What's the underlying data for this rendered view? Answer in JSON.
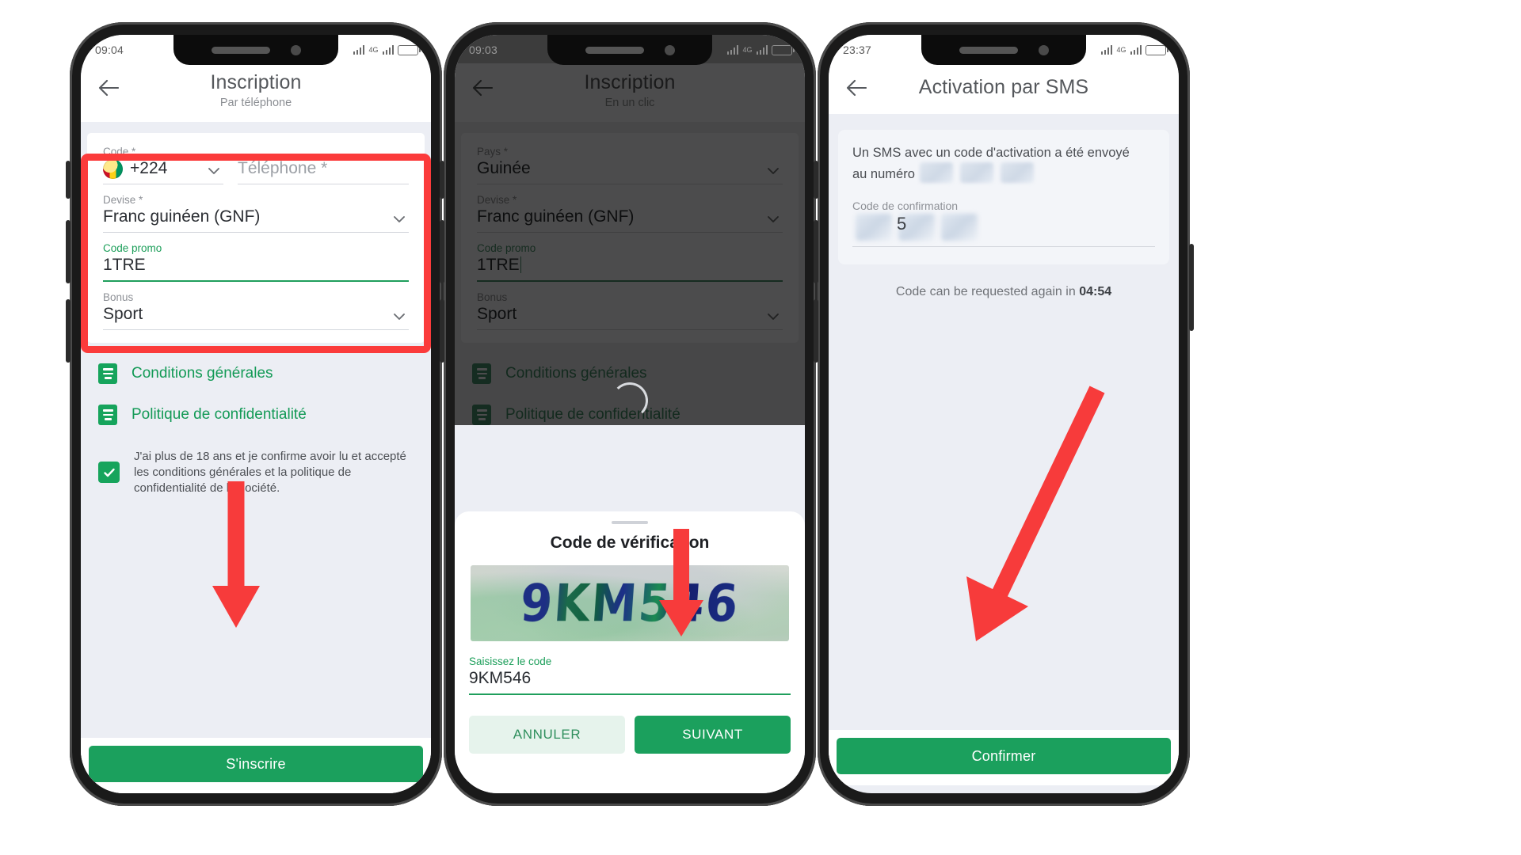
{
  "phone1": {
    "statusbar": {
      "time": "09:04",
      "battery": ""
    },
    "header": {
      "title": "Inscription",
      "subtitle": "Par téléphone"
    },
    "fields": [
      {
        "label": "Code *",
        "value": "+224",
        "flag": "guinea-flag-icon",
        "type": "select"
      },
      {
        "label": "",
        "value": "",
        "placeholder": "Téléphone *",
        "type": "text"
      },
      {
        "label": "Devise *",
        "value": "Franc guinéen (GNF)",
        "type": "select"
      },
      {
        "label": "Code promo",
        "value": "1TRE",
        "type": "text"
      },
      {
        "label": "Bonus",
        "value": "Sport",
        "type": "select"
      }
    ],
    "links": [
      {
        "label": "Conditions générales",
        "icon": "document-icon"
      },
      {
        "label": "Politique de confidentialité",
        "icon": "document-icon"
      }
    ],
    "consent": "J'ai plus de 18 ans et je confirme avoir lu et accepté les conditions générales et la politique de confidentialité de la société.",
    "cta": "S'inscrire"
  },
  "phone2": {
    "statusbar": {
      "time": "09:03"
    },
    "header": {
      "title": "Inscription",
      "subtitle": "En un clic"
    },
    "fields": [
      {
        "label": "Pays *",
        "value": "Guinée",
        "type": "select"
      },
      {
        "label": "Devise *",
        "value": "Franc guinéen (GNF)",
        "type": "select"
      },
      {
        "label": "Code promo",
        "value": "1TRE",
        "type": "text"
      },
      {
        "label": "Bonus",
        "value": "Sport",
        "type": "select"
      }
    ],
    "links": [
      {
        "label": "Conditions générales",
        "icon": "document-icon"
      },
      {
        "label": "Politique de confidentialité",
        "icon": "document-icon"
      }
    ],
    "sheet": {
      "title": "Code de vérification",
      "captcha_text": "9KM546",
      "input_label": "Saisissez le code",
      "input_value": "9KM546",
      "cancel": "ANNULER",
      "next": "SUIVANT"
    }
  },
  "phone3": {
    "statusbar": {
      "time": "23:37"
    },
    "header": {
      "title": "Activation par SMS"
    },
    "sms_text_line1": "Un SMS avec un code d'activation a été envoyé",
    "sms_text_line2": "au numéro",
    "confirm_label": "Code de confirmation",
    "code_digit": "5",
    "again_prefix": "Code can be requested again in",
    "again_time": "04:54",
    "cta": "Confirmer"
  },
  "colors": {
    "brand_green": "#1ba05d",
    "link_green": "#139a56",
    "highlight_red": "#fb3b3b",
    "arrow_red": "#f73b3b",
    "screen_bg": "#eceef4"
  }
}
